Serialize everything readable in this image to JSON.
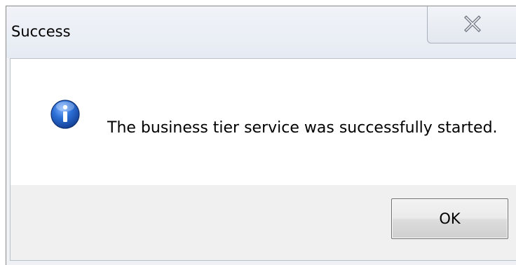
{
  "window": {
    "title": "Success"
  },
  "close_button": {
    "icon": "close-icon"
  },
  "content": {
    "icon": "info-icon",
    "message": "The business tier service was successfully started."
  },
  "buttons": {
    "ok_label": "OK"
  },
  "colors": {
    "titlebar": "#e9eef5",
    "content_bg": "#ffffff",
    "button_bar_bg": "#f0f0f0",
    "info_icon_blue": "#1f5fbf"
  }
}
